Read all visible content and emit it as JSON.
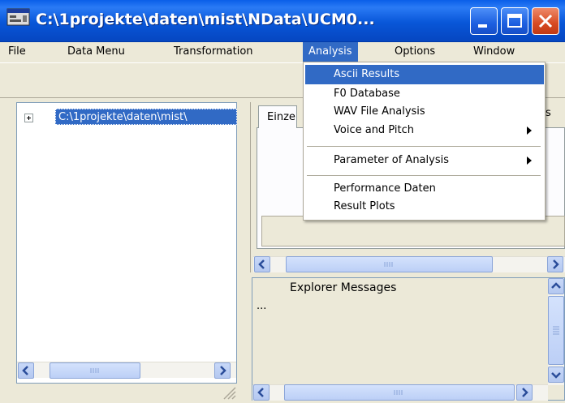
{
  "window": {
    "title": "C:\\1projekte\\daten\\mist\\NData\\UCM0...",
    "colors": {
      "titlebar": "#0a5fe8",
      "selection": "#316ac5",
      "face": "#ece9d8"
    }
  },
  "menubar": {
    "items": [
      "File",
      "Data Menu",
      "Transformation",
      "Analysis",
      "Options",
      "Window"
    ],
    "active": "Analysis"
  },
  "analysis_menu": {
    "items": [
      {
        "label": "Ascii Results",
        "highlighted": true
      },
      {
        "label": "F0 Database"
      },
      {
        "label": "WAV File Analysis"
      },
      {
        "label": "Voice and Pitch",
        "submenu": true
      },
      {
        "label": "Parameter of Analysis",
        "submenu": true
      },
      {
        "label": "Performance Daten"
      },
      {
        "label": "Result Plots"
      }
    ]
  },
  "tree": {
    "root_label": "C:\\1projekte\\daten\\mist\\"
  },
  "tabs": {
    "first": "Einze",
    "partial_right": "s"
  },
  "explorer": {
    "title": "Explorer Messages",
    "content": "..."
  },
  "icons": {
    "app": "window-app-icon",
    "minimize": "minimize-icon",
    "maximize": "maximize-icon",
    "close": "close-icon",
    "expand": "plus-icon",
    "left": "arrow-left-icon",
    "right": "arrow-right-icon",
    "up": "arrow-up-icon",
    "down": "arrow-down-icon",
    "submenu": "submenu-arrow-icon"
  }
}
